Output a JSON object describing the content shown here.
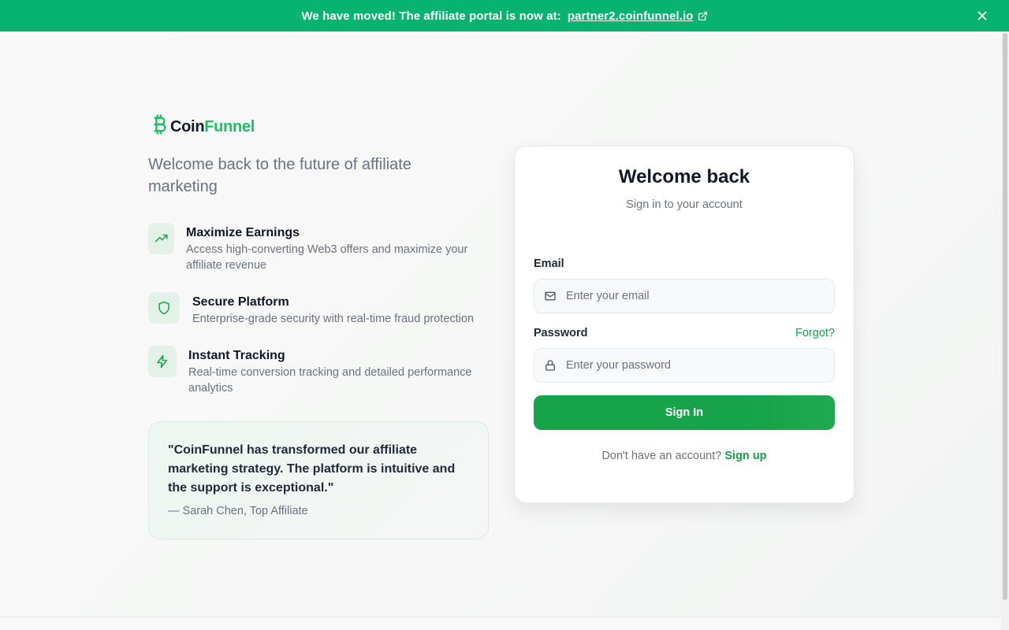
{
  "banner": {
    "text": "We have moved! The affiliate portal is now at:",
    "link": "partner2.coinfunnel.io",
    "icons": [
      "external-link-icon",
      "close-icon"
    ],
    "color": "#07b36e"
  },
  "brand": {
    "name_part1": "Coin",
    "name_part2": "Funnel",
    "logo_icon": "bitcoin-icon",
    "accent": "#16a34a"
  },
  "hero": {
    "tagline": "Welcome back to the future of affiliate marketing"
  },
  "features": [
    {
      "icon": "trending-up-icon",
      "title": "Maximize Earnings",
      "desc": "Access high-converting Web3 offers and maximize your affiliate revenue"
    },
    {
      "icon": "shield-icon",
      "title": "Secure Platform",
      "desc": "Enterprise-grade security with real-time fraud protection"
    },
    {
      "icon": "zap-icon",
      "title": "Instant Tracking",
      "desc": "Real-time conversion tracking and detailed performance analytics"
    }
  ],
  "testimonial": {
    "quote": "\"CoinFunnel has transformed our affiliate marketing strategy. The platform is intuitive and the support is exceptional.\"",
    "author": "— Sarah Chen, Top Affiliate"
  },
  "login": {
    "title": "Welcome back",
    "subtitle": "Sign in to your account",
    "email_label": "Email",
    "email_placeholder": "Enter your email",
    "email_value": "",
    "password_label": "Password",
    "forgot_label": "Forgot?",
    "password_placeholder": "Enter your password",
    "password_value": "",
    "signin_label": "Sign In",
    "no_account_text": "Don't have an account?",
    "signup_label": "Sign up"
  }
}
